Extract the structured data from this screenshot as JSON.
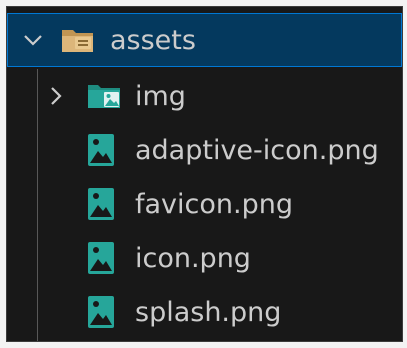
{
  "tree": {
    "root": {
      "label": "assets",
      "expanded": true,
      "icon": "folder-open-icon"
    },
    "children": [
      {
        "label": "img",
        "type": "folder",
        "expanded": false,
        "icon": "image-folder-icon"
      },
      {
        "label": "adaptive-icon.png",
        "type": "file",
        "icon": "image-file-icon"
      },
      {
        "label": "favicon.png",
        "type": "file",
        "icon": "image-file-icon"
      },
      {
        "label": "icon.png",
        "type": "file",
        "icon": "image-file-icon"
      },
      {
        "label": "splash.png",
        "type": "file",
        "icon": "image-file-icon"
      }
    ]
  },
  "colors": {
    "background": "#181818",
    "selection": "#04395e",
    "focus_border": "#0078d4",
    "text": "#cccccc",
    "folder": "#dcb67a",
    "image_icon": "#26a69a"
  }
}
